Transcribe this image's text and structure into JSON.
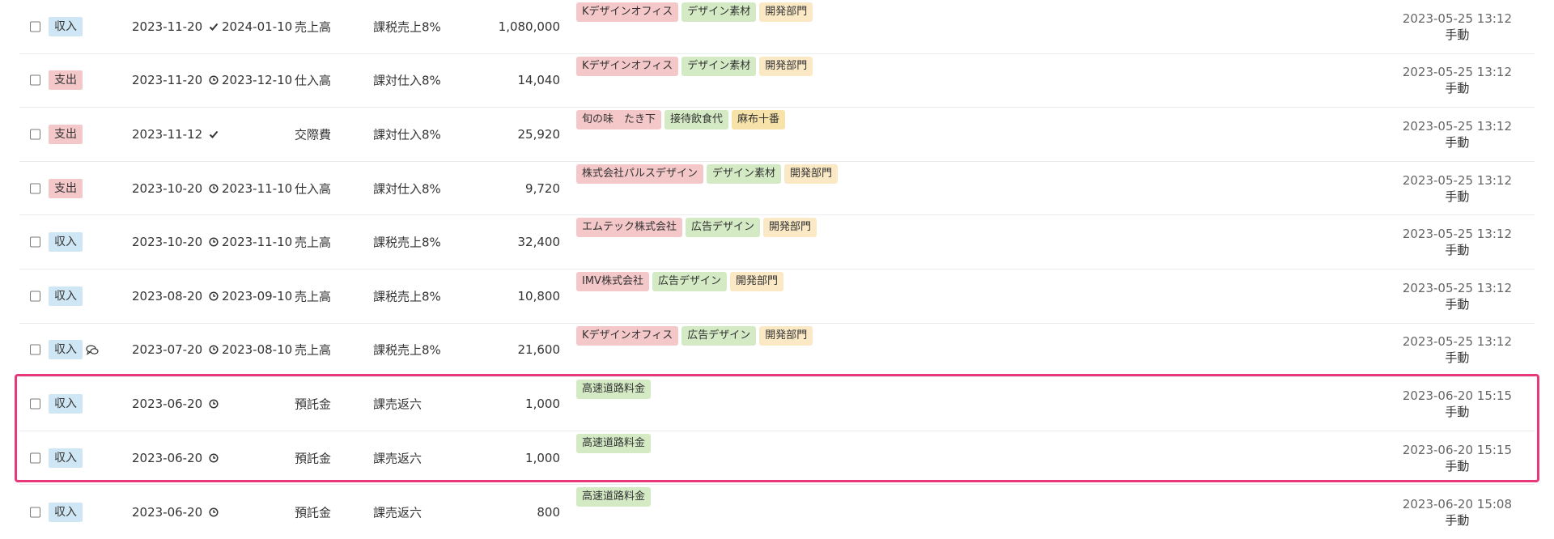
{
  "rows": [
    {
      "type": "収入",
      "type_kind": "income",
      "has_comment": false,
      "date": "2023-11-20",
      "settle_status": "check",
      "settle_date": "2024-01-10",
      "account": "売上高",
      "tax": "課税売上8%",
      "amount": "1,080,000",
      "tags": [
        {
          "text": "Kデザインオフィス",
          "kind": "partner"
        },
        {
          "text": "デザイン素材",
          "kind": "item"
        },
        {
          "text": "開発部門",
          "kind": "section"
        }
      ],
      "updated": "2023-05-25 13:12",
      "method": "手動"
    },
    {
      "type": "支出",
      "type_kind": "expense",
      "has_comment": false,
      "date": "2023-11-20",
      "settle_status": "clock",
      "settle_date": "2023-12-10",
      "account": "仕入高",
      "tax": "課対仕入8%",
      "amount": "14,040",
      "tags": [
        {
          "text": "Kデザインオフィス",
          "kind": "partner"
        },
        {
          "text": "デザイン素材",
          "kind": "item"
        },
        {
          "text": "開発部門",
          "kind": "section"
        }
      ],
      "updated": "2023-05-25 13:12",
      "method": "手動"
    },
    {
      "type": "支出",
      "type_kind": "expense",
      "has_comment": false,
      "date": "2023-11-12",
      "settle_status": "check",
      "settle_date": "",
      "account": "交際費",
      "tax": "課対仕入8%",
      "amount": "25,920",
      "tags": [
        {
          "text": "旬の味　たき下",
          "kind": "partner"
        },
        {
          "text": "接待飲食代",
          "kind": "item"
        },
        {
          "text": "麻布十番",
          "kind": "memo"
        }
      ],
      "updated": "2023-05-25 13:12",
      "method": "手動"
    },
    {
      "type": "支出",
      "type_kind": "expense",
      "has_comment": false,
      "date": "2023-10-20",
      "settle_status": "clock",
      "settle_date": "2023-11-10",
      "account": "仕入高",
      "tax": "課対仕入8%",
      "amount": "9,720",
      "tags": [
        {
          "text": "株式会社パルスデザイン",
          "kind": "partner"
        },
        {
          "text": "デザイン素材",
          "kind": "item"
        },
        {
          "text": "開発部門",
          "kind": "section"
        }
      ],
      "updated": "2023-05-25 13:12",
      "method": "手動"
    },
    {
      "type": "収入",
      "type_kind": "income",
      "has_comment": false,
      "date": "2023-10-20",
      "settle_status": "clock",
      "settle_date": "2023-11-10",
      "account": "売上高",
      "tax": "課税売上8%",
      "amount": "32,400",
      "tags": [
        {
          "text": "エムテック株式会社",
          "kind": "partner"
        },
        {
          "text": "広告デザイン",
          "kind": "item"
        },
        {
          "text": "開発部門",
          "kind": "section"
        }
      ],
      "updated": "2023-05-25 13:12",
      "method": "手動"
    },
    {
      "type": "収入",
      "type_kind": "income",
      "has_comment": false,
      "date": "2023-08-20",
      "settle_status": "clock",
      "settle_date": "2023-09-10",
      "account": "売上高",
      "tax": "課税売上8%",
      "amount": "10,800",
      "tags": [
        {
          "text": "IMV株式会社",
          "kind": "partner"
        },
        {
          "text": "広告デザイン",
          "kind": "item"
        },
        {
          "text": "開発部門",
          "kind": "section"
        }
      ],
      "updated": "2023-05-25 13:12",
      "method": "手動"
    },
    {
      "type": "収入",
      "type_kind": "income",
      "has_comment": true,
      "date": "2023-07-20",
      "settle_status": "clock",
      "settle_date": "2023-08-10",
      "account": "売上高",
      "tax": "課税売上8%",
      "amount": "21,600",
      "tags": [
        {
          "text": "Kデザインオフィス",
          "kind": "partner"
        },
        {
          "text": "広告デザイン",
          "kind": "item"
        },
        {
          "text": "開発部門",
          "kind": "section"
        }
      ],
      "updated": "2023-05-25 13:12",
      "method": "手動"
    },
    {
      "type": "収入",
      "type_kind": "income",
      "has_comment": false,
      "date": "2023-06-20",
      "settle_status": "clock",
      "settle_date": "",
      "account": "預託金",
      "tax": "課売返六",
      "amount": "1,000",
      "tags": [
        {
          "text": "高速道路料金",
          "kind": "item"
        }
      ],
      "updated": "2023-06-20 15:15",
      "method": "手動"
    },
    {
      "type": "収入",
      "type_kind": "income",
      "has_comment": false,
      "date": "2023-06-20",
      "settle_status": "clock",
      "settle_date": "",
      "account": "預託金",
      "tax": "課売返六",
      "amount": "1,000",
      "tags": [
        {
          "text": "高速道路料金",
          "kind": "item"
        }
      ],
      "updated": "2023-06-20 15:15",
      "method": "手動"
    },
    {
      "type": "収入",
      "type_kind": "income",
      "has_comment": false,
      "date": "2023-06-20",
      "settle_status": "clock",
      "settle_date": "",
      "account": "預託金",
      "tax": "課売返六",
      "amount": "800",
      "tags": [
        {
          "text": "高速道路料金",
          "kind": "item"
        }
      ],
      "updated": "2023-06-20 15:08",
      "method": "手動"
    }
  ],
  "highlight_color": "#e8387a"
}
